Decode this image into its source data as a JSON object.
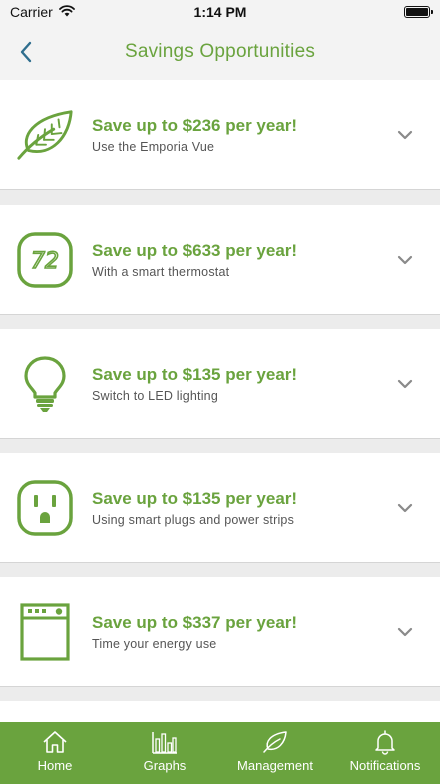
{
  "status_bar": {
    "carrier": "Carrier",
    "time": "1:14 PM"
  },
  "header": {
    "title": "Savings Opportunities"
  },
  "colors": {
    "brand_green": "#6aa33e",
    "chevron_gray": "#8a8a8a"
  },
  "opportunities": [
    {
      "icon": "leaf-icon",
      "title": "Save up to $236 per year!",
      "subtitle": "Use the Emporia Vue"
    },
    {
      "icon": "thermostat-72-icon",
      "title": "Save up to $633 per year!",
      "subtitle": "With a smart thermostat"
    },
    {
      "icon": "light-bulb-icon",
      "title": "Save up to $135 per year!",
      "subtitle": "Switch to LED lighting"
    },
    {
      "icon": "power-outlet-icon",
      "title": "Save up to $135 per year!",
      "subtitle": "Using smart plugs and power strips"
    },
    {
      "icon": "appliance-oven-icon",
      "title": "Save up to $337 per year!",
      "subtitle": "Time your energy use"
    }
  ],
  "tab_bar": {
    "tabs": [
      {
        "icon": "home-icon",
        "label": "Home"
      },
      {
        "icon": "bar-chart-icon",
        "label": "Graphs"
      },
      {
        "icon": "leaf-icon",
        "label": "Management"
      },
      {
        "icon": "bell-icon",
        "label": "Notifications"
      }
    ]
  }
}
